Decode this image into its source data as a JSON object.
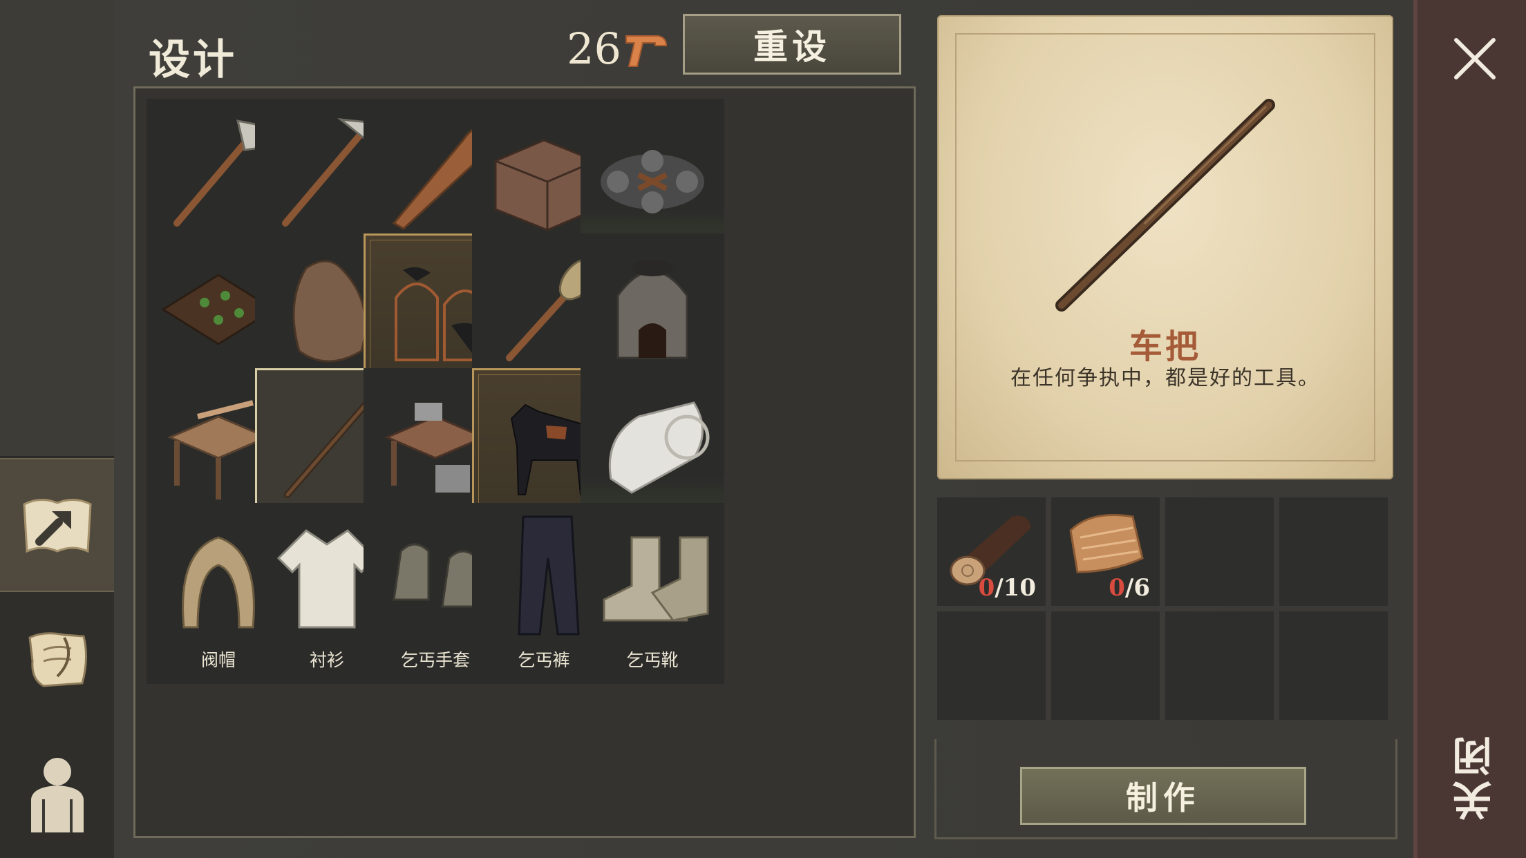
{
  "header": {
    "title": "设计",
    "points": "26",
    "reset_label": "重设"
  },
  "grid": {
    "rows": [
      [
        {
          "label": "石斧",
          "icon": "stone-axe-icon",
          "state": "normal"
        },
        {
          "label": "石镐",
          "icon": "stone-pickaxe-icon",
          "state": "normal"
        },
        {
          "label": "棍子",
          "icon": "club-icon",
          "state": "normal"
        },
        {
          "label": "农家箱子",
          "icon": "chest-icon",
          "state": "normal"
        },
        {
          "label": "火",
          "icon": "campfire-icon",
          "state": "green"
        }
      ],
      [
        {
          "label": "花园苗床",
          "icon": "garden-bed-icon",
          "state": "normal"
        },
        {
          "label": "破麻袋",
          "icon": "sack-icon",
          "state": "normal"
        },
        {
          "label": "渡鸦笼",
          "icon": "raven-cage-icon",
          "state": "gold"
        },
        {
          "label": "火把",
          "icon": "torch-icon",
          "state": "normal"
        },
        {
          "label": "熔炉",
          "icon": "furnace-icon",
          "state": "normal"
        }
      ],
      [
        {
          "label": "木工台",
          "icon": "carpentry-bench-icon",
          "state": "normal"
        },
        {
          "label": "车把",
          "icon": "shaft-icon",
          "state": "selected"
        },
        {
          "label": "石匠台",
          "icon": "mason-bench-icon",
          "state": "normal"
        },
        {
          "label": "马厩",
          "icon": "horse-stable-icon",
          "state": "gold"
        },
        {
          "label": "绷带",
          "icon": "bandage-icon",
          "state": "green"
        }
      ],
      [
        {
          "label": "阀帽",
          "icon": "hood-icon",
          "state": "normal"
        },
        {
          "label": "衬衫",
          "icon": "shirt-icon",
          "state": "normal"
        },
        {
          "label": "乞丐手套",
          "icon": "gloves-icon",
          "state": "normal"
        },
        {
          "label": "乞丐裤",
          "icon": "pants-icon",
          "state": "normal"
        },
        {
          "label": "乞丐靴",
          "icon": "boots-icon",
          "state": "normal"
        }
      ]
    ]
  },
  "detail": {
    "name": "车把",
    "description": "在任何争执中，都是好的工具。",
    "icon": "shaft-icon",
    "requirements": [
      {
        "icon": "log-icon",
        "have": "0",
        "need": "/10"
      },
      {
        "icon": "plant-fiber-icon",
        "have": "0",
        "need": "/6"
      }
    ],
    "craft_label": "制作"
  },
  "close": {
    "label": "关闭"
  },
  "colors": {
    "accent_name": "#a55a38",
    "missing": "#d94b3f",
    "selected_border": "#d9cfa8",
    "gold_border": "#b9975a",
    "green_border": "#7f9a62"
  }
}
